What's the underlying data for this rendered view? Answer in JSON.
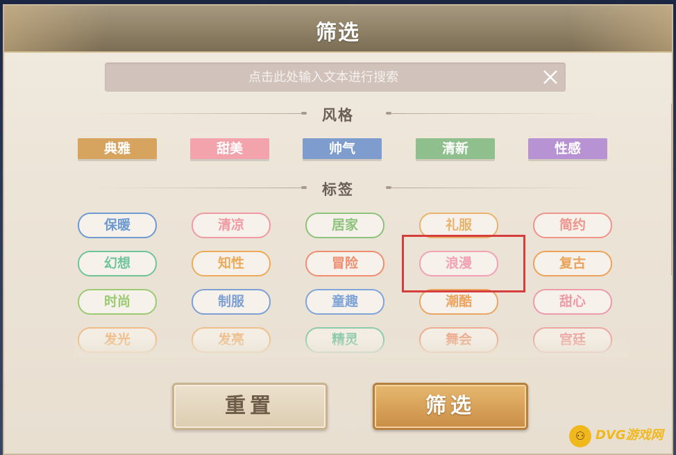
{
  "header": {
    "title": "筛选"
  },
  "search": {
    "placeholder": "点击此处输入文本进行搜索"
  },
  "styles": {
    "title": "风格",
    "items": [
      {
        "label": "典雅",
        "color": "#d6a45f"
      },
      {
        "label": "甜美",
        "color": "#f2a3ac"
      },
      {
        "label": "帅气",
        "color": "#7e9ccd"
      },
      {
        "label": "清新",
        "color": "#8fbf8c"
      },
      {
        "label": "性感",
        "color": "#b793d3"
      }
    ]
  },
  "tags": {
    "title": "标签",
    "items": [
      {
        "label": "保暖",
        "color": "#6c9ad1"
      },
      {
        "label": "清凉",
        "color": "#ef9aa3"
      },
      {
        "label": "居家",
        "color": "#8cc27c"
      },
      {
        "label": "礼服",
        "color": "#e8b46c"
      },
      {
        "label": "简约",
        "color": "#ef938b"
      },
      {
        "label": "幻想",
        "color": "#6ec49b"
      },
      {
        "label": "知性",
        "color": "#ecab5a"
      },
      {
        "label": "冒险",
        "color": "#ee8d6f"
      },
      {
        "label": "浪漫",
        "color": "#f2a1b4"
      },
      {
        "label": "复古",
        "color": "#eca258"
      },
      {
        "label": "时尚",
        "color": "#9acb73"
      },
      {
        "label": "制服",
        "color": "#7d9fd3"
      },
      {
        "label": "童趣",
        "color": "#7fa4d8"
      },
      {
        "label": "潮酷",
        "color": "#eba561"
      },
      {
        "label": "甜心",
        "color": "#ef9aa8"
      },
      {
        "label": "发光",
        "color": "#f2b16f"
      },
      {
        "label": "发亮",
        "color": "#f0b474"
      },
      {
        "label": "精灵",
        "color": "#6cc39f"
      },
      {
        "label": "舞会",
        "color": "#ee9c7a"
      },
      {
        "label": "宫廷",
        "color": "#ef9492"
      }
    ]
  },
  "buttons": {
    "reset": "重置",
    "filter": "筛选"
  },
  "watermark": {
    "text": "DVG游戏网"
  }
}
